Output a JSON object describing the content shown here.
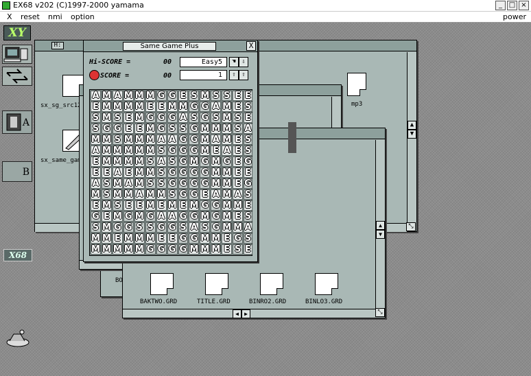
{
  "window": {
    "title": "EX68 v202 (C)1997-2000 yamama",
    "min": "_",
    "max": "□",
    "close": "×"
  },
  "menu": {
    "x": "X",
    "reset": "reset",
    "nmi": "nmi",
    "option": "option",
    "power": "power"
  },
  "sidebar": {
    "logo_top": "XY",
    "drive_a": "A",
    "drive_b": "B",
    "logo_bottom": "X68"
  },
  "file_windows": {
    "w1": {
      "drive": "H:",
      "files": [
        "sx_sg_src12",
        "sx_same_gam",
        "mp3"
      ],
      "partial": "lb"
    },
    "w2": {
      "partial": "b"
    },
    "w3": {
      "files": [
        "BAKTWO.GRD",
        "TITLE.GRD",
        "BINRO2.GRD",
        "BINLO3.GRD"
      ]
    },
    "w4": {
      "partial_top": "B",
      "partial_bottom": "BO"
    }
  },
  "game": {
    "title": "Same Game Plus",
    "close": "X",
    "hiscore_label": "Hi-SCORE =",
    "hiscore_value": "00",
    "score_label": "SCORE =",
    "score_value": "00",
    "level": "Easy5",
    "counter": "1",
    "board": [
      "AMAMMMGGESMSSEE",
      "EMMMMEEMMGGAMES",
      "SMSEMGGGASGSMSE",
      "SGGEEMGSSGMMMSA",
      "MMSMMMAAGGMAMES",
      "AMMMMMSGGGMEAES",
      "EMMMMSASGMGMGEG",
      "EEAEMMSGGGGMMEE",
      "ASMAMSSGGGGMMEG",
      "MSMMAMMSGGEAMAS",
      "EMSEEMEMEMGGMMEG",
      "GEMGMGAAGGMGMES",
      "SMGGSSGGSASGMMA",
      "MMEMMMEEGGMMEGS",
      "MMMMMGGGGMMMESE"
    ]
  }
}
